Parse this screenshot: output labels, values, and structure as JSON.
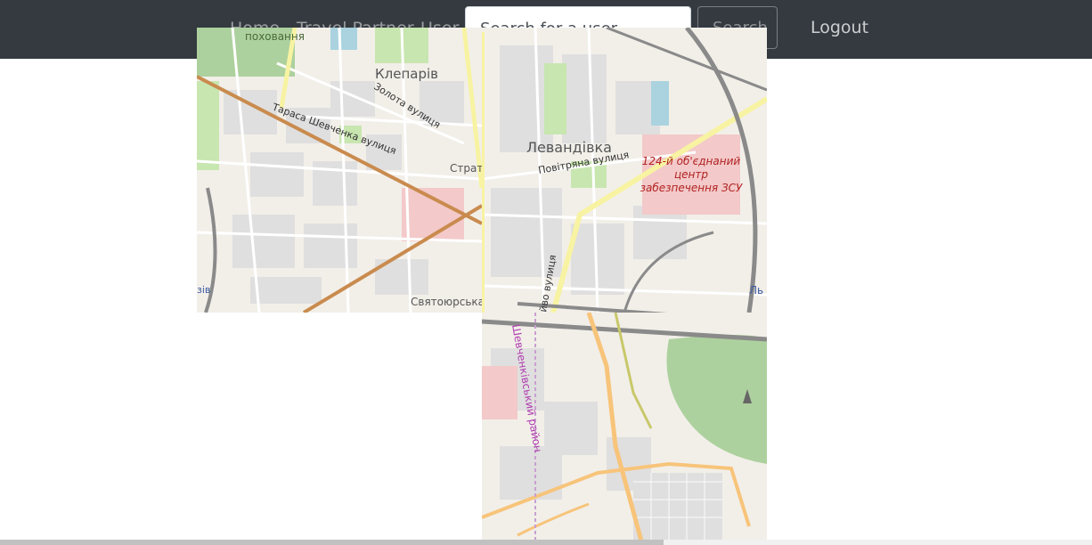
{
  "navbar": {
    "links": [
      "Home",
      "Travel Partner",
      "User"
    ],
    "search_placeholder": "Search for a user",
    "search_button": "Search",
    "logout": "Logout"
  },
  "map": {
    "labels": {
      "cemetery": "поховання",
      "klepariv": "Клепарів",
      "zolota": "Золота вулиця",
      "shevchenka": "Тараса Шевченка вулиця",
      "strat": "Страт",
      "levandivka": "Левандівка",
      "povitriana": "Повітряна вулиця",
      "military": "124-й об'єднаний центр забезпечення ЗСУ",
      "svyatoyurska": "Святоюрська",
      "zviv": "зів",
      "vulytsia": "йво вулиця",
      "lv": "Ль",
      "district": "Шевченківський район"
    },
    "colors": {
      "land": "#f2efe9",
      "residential": "#e0dfdf",
      "green": "#c8e6b0",
      "park": "#add19e",
      "road_major": "#f7c47a",
      "road_primary": "#c98b4e",
      "railway": "#8a8a8a",
      "water": "#aad3df",
      "military": "#f3c9c9"
    }
  }
}
